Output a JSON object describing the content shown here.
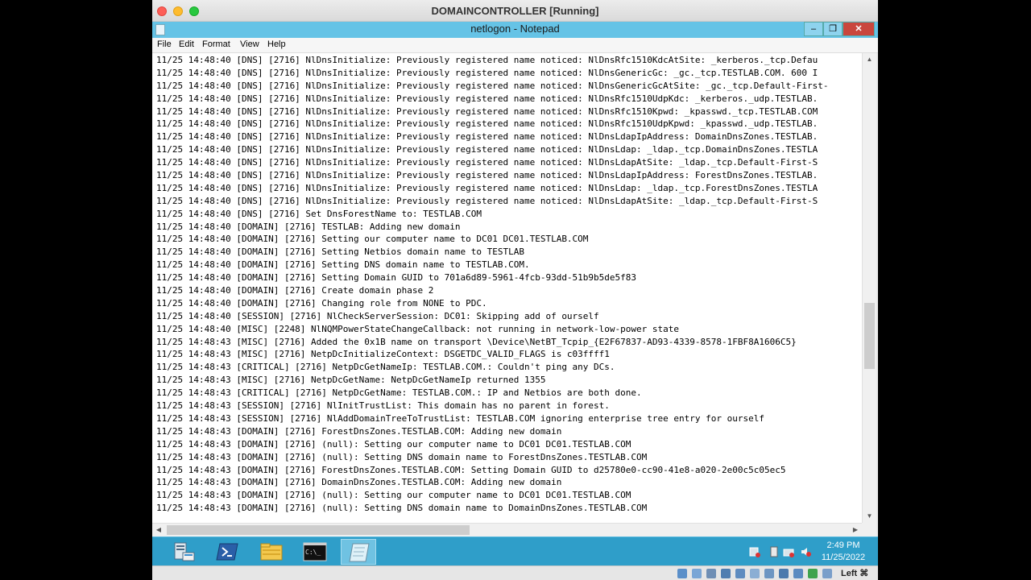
{
  "vm": {
    "title": "DOMAINCONTROLLER [Running]"
  },
  "notepad": {
    "title": "netlogon - Notepad",
    "controls": {
      "minimize": "–",
      "restore": "❐",
      "close": "✕"
    }
  },
  "menu": [
    "File",
    "Edit",
    "Format",
    "View",
    "Help"
  ],
  "log_lines": [
    "11/25 14:48:40 [DNS] [2716] NlDnsInitialize: Previously registered name noticed: NlDnsRfc1510KdcAtSite: _kerberos._tcp.Defau",
    "11/25 14:48:40 [DNS] [2716] NlDnsInitialize: Previously registered name noticed: NlDnsGenericGc: _gc._tcp.TESTLAB.COM. 600 I",
    "11/25 14:48:40 [DNS] [2716] NlDnsInitialize: Previously registered name noticed: NlDnsGenericGcAtSite: _gc._tcp.Default-First-",
    "11/25 14:48:40 [DNS] [2716] NlDnsInitialize: Previously registered name noticed: NlDnsRfc1510UdpKdc: _kerberos._udp.TESTLAB.",
    "11/25 14:48:40 [DNS] [2716] NlDnsInitialize: Previously registered name noticed: NlDnsRfc1510Kpwd: _kpasswd._tcp.TESTLAB.COM",
    "11/25 14:48:40 [DNS] [2716] NlDnsInitialize: Previously registered name noticed: NlDnsRfc1510UdpKpwd: _kpasswd._udp.TESTLAB.",
    "11/25 14:48:40 [DNS] [2716] NlDnsInitialize: Previously registered name noticed: NlDnsLdapIpAddress: DomainDnsZones.TESTLAB.",
    "11/25 14:48:40 [DNS] [2716] NlDnsInitialize: Previously registered name noticed: NlDnsLdap: _ldap._tcp.DomainDnsZones.TESTLA",
    "11/25 14:48:40 [DNS] [2716] NlDnsInitialize: Previously registered name noticed: NlDnsLdapAtSite: _ldap._tcp.Default-First-S",
    "11/25 14:48:40 [DNS] [2716] NlDnsInitialize: Previously registered name noticed: NlDnsLdapIpAddress: ForestDnsZones.TESTLAB.",
    "11/25 14:48:40 [DNS] [2716] NlDnsInitialize: Previously registered name noticed: NlDnsLdap: _ldap._tcp.ForestDnsZones.TESTLA",
    "11/25 14:48:40 [DNS] [2716] NlDnsInitialize: Previously registered name noticed: NlDnsLdapAtSite: _ldap._tcp.Default-First-S",
    "11/25 14:48:40 [DNS] [2716] Set DnsForestName to: TESTLAB.COM",
    "11/25 14:48:40 [DOMAIN] [2716] TESTLAB: Adding new domain",
    "11/25 14:48:40 [DOMAIN] [2716] Setting our computer name to DC01 DC01.TESTLAB.COM",
    "11/25 14:48:40 [DOMAIN] [2716] Setting Netbios domain name to TESTLAB",
    "11/25 14:48:40 [DOMAIN] [2716] Setting DNS domain name to TESTLAB.COM.",
    "11/25 14:48:40 [DOMAIN] [2716] Setting Domain GUID to 701a6d89-5961-4fcb-93dd-51b9b5de5f83",
    "11/25 14:48:40 [DOMAIN] [2716] Create domain phase 2",
    "11/25 14:48:40 [DOMAIN] [2716] Changing role from NONE to PDC.",
    "11/25 14:48:40 [SESSION] [2716] NlCheckServerSession: DC01: Skipping add of ourself",
    "11/25 14:48:40 [MISC] [2248] NlNQMPowerStateChangeCallback: not running in network-low-power state",
    "11/25 14:48:43 [MISC] [2716] Added the 0x1B name on transport \\Device\\NetBT_Tcpip_{E2F67837-AD93-4339-8578-1FBF8A1606C5}",
    "11/25 14:48:43 [MISC] [2716] NetpDcInitializeContext: DSGETDC_VALID_FLAGS is c03ffff1",
    "11/25 14:48:43 [CRITICAL] [2716] NetpDcGetNameIp: TESTLAB.COM.: Couldn't ping any DCs.",
    "11/25 14:48:43 [MISC] [2716] NetpDcGetName: NetpDcGetNameIp returned 1355",
    "11/25 14:48:43 [CRITICAL] [2716] NetpDcGetName: TESTLAB.COM.: IP and Netbios are both done.",
    "11/25 14:48:43 [SESSION] [2716] NlInitTrustList: This domain has no parent in forest.",
    "11/25 14:48:43 [SESSION] [2716] NlAddDomainTreeToTrustList: TESTLAB.COM ignoring enterprise tree entry for ourself",
    "11/25 14:48:43 [DOMAIN] [2716] ForestDnsZones.TESTLAB.COM: Adding new domain",
    "11/25 14:48:43 [DOMAIN] [2716] (null): Setting our computer name to DC01 DC01.TESTLAB.COM",
    "11/25 14:48:43 [DOMAIN] [2716] (null): Setting DNS domain name to ForestDnsZones.TESTLAB.COM",
    "11/25 14:48:43 [DOMAIN] [2716] ForestDnsZones.TESTLAB.COM: Setting Domain GUID to d25780e0-cc90-41e8-a020-2e00c5c05ec5",
    "11/25 14:48:43 [DOMAIN] [2716] DomainDnsZones.TESTLAB.COM: Adding new domain",
    "11/25 14:48:43 [DOMAIN] [2716] (null): Setting our computer name to DC01 DC01.TESTLAB.COM",
    "11/25 14:48:43 [DOMAIN] [2716] (null): Setting DNS domain name to DomainDnsZones.TESTLAB.COM"
  ],
  "taskbar": {
    "time": "2:49 PM",
    "date": "11/25/2022",
    "cmd_glyph": "C:\\_",
    "apps": [
      "server-manager-icon",
      "powershell-icon",
      "file-explorer-icon",
      "cmd-icon",
      "notepad-icon"
    ]
  },
  "statusbar": {
    "host_key": "Left ⌘"
  },
  "colors": {
    "taskbar": "#2f9ec9",
    "titlebar": "#65c3e6",
    "close": "#c9463d"
  }
}
